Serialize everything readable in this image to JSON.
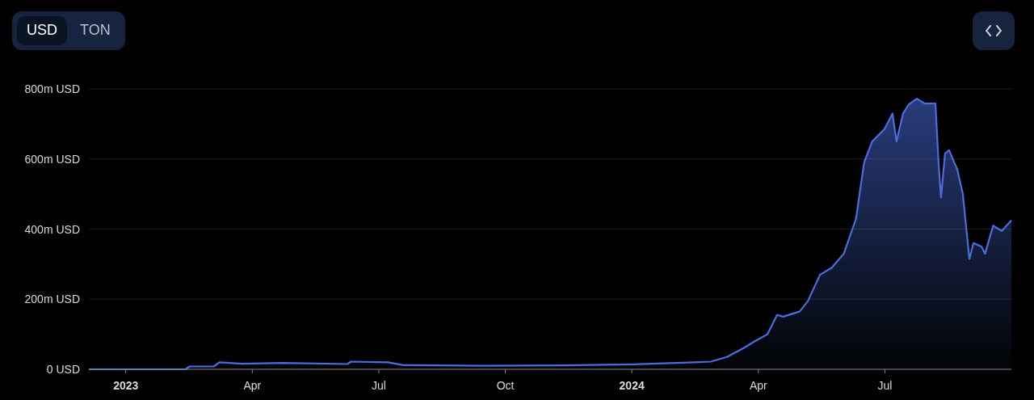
{
  "currency_toggle": [
    {
      "label": "USD",
      "selected": true
    },
    {
      "label": "TON",
      "selected": false
    }
  ],
  "chart": {
    "chart_data": {
      "type": "area",
      "x": [
        2022.927,
        2023.118,
        2023.126,
        2023.174,
        2023.185,
        2023.23,
        2023.31,
        2023.438,
        2023.445,
        2023.518,
        2023.549,
        2023.709,
        2023.868,
        2024.003,
        2024.124,
        2024.156,
        2024.188,
        2024.22,
        2024.243,
        2024.268,
        2024.287,
        2024.299,
        2024.332,
        2024.348,
        2024.372,
        2024.395,
        2024.419,
        2024.443,
        2024.459,
        2024.475,
        2024.499,
        2024.515,
        2024.523,
        2024.536,
        2024.547,
        2024.563,
        2024.579,
        2024.6,
        2024.606,
        2024.611,
        2024.619,
        2024.627,
        2024.643,
        2024.654,
        2024.667,
        2024.675,
        2024.691,
        2024.698,
        2024.714,
        2024.731,
        2024.75
      ],
      "series": [
        {
          "color": "#4a6ee0",
          "values": [
            0,
            0,
            8,
            8,
            20,
            16,
            18,
            15,
            22,
            20,
            12,
            10,
            11,
            14,
            20,
            22,
            35,
            60,
            80,
            100,
            155,
            150,
            165,
            195,
            270,
            290,
            330,
            430,
            590,
            650,
            685,
            730,
            650,
            730,
            755,
            772,
            758,
            758,
            590,
            490,
            615,
            625,
            570,
            500,
            315,
            360,
            350,
            330,
            410,
            395,
            425
          ]
        }
      ],
      "grid": true,
      "xlim": [
        2022.927,
        2024.75
      ],
      "ylim": [
        0,
        800
      ],
      "xticks": [
        2023,
        {
          "value": 2023.25,
          "label": "Apr"
        },
        {
          "value": 2023.5,
          "label": "Jul"
        },
        {
          "value": 2023.75,
          "label": "Oct"
        },
        2024,
        {
          "value": 2024.25,
          "label": "Apr"
        },
        {
          "value": 2024.5,
          "label": "Jul"
        }
      ],
      "yticks": [
        {
          "value": 0,
          "label": "0 USD"
        },
        {
          "value": 200,
          "label": "200m USD"
        },
        {
          "value": 400,
          "label": "400m USD"
        },
        {
          "value": 600,
          "label": "600m USD"
        },
        {
          "value": 800,
          "label": "800m USD"
        }
      ]
    }
  }
}
